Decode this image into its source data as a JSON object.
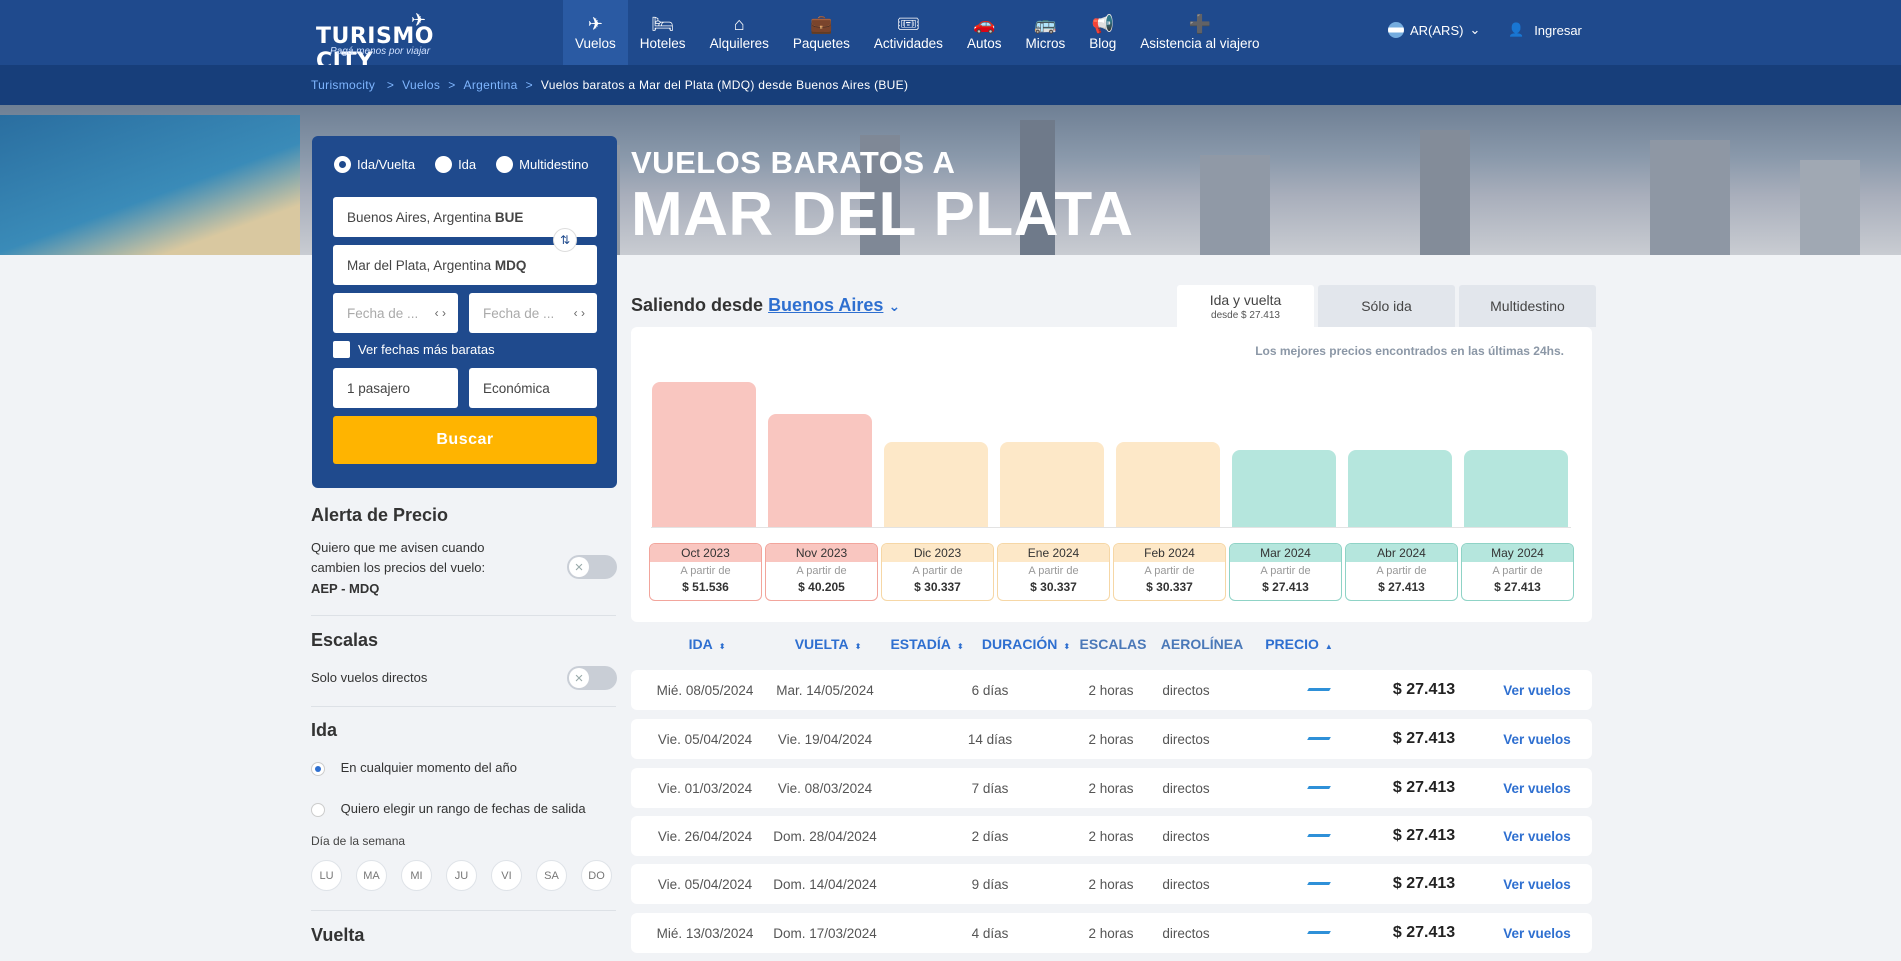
{
  "brand": {
    "name": "TURISMO CITY",
    "slogan": "Pagá menos por viajar"
  },
  "nav": [
    {
      "label": "Vuelos",
      "icon": "plane-icon",
      "glyph": "✈",
      "active": true
    },
    {
      "label": "Hoteles",
      "icon": "bed-icon",
      "glyph": "🛏",
      "active": false
    },
    {
      "label": "Alquileres",
      "icon": "house-icon",
      "glyph": "⌂",
      "active": false
    },
    {
      "label": "Paquetes",
      "icon": "suitcase-icon",
      "glyph": "💼",
      "active": false
    },
    {
      "label": "Actividades",
      "icon": "ticket-icon",
      "glyph": "🎟",
      "active": false
    },
    {
      "label": "Autos",
      "icon": "car-icon",
      "glyph": "🚗",
      "active": false
    },
    {
      "label": "Micros",
      "icon": "bus-icon",
      "glyph": "🚌",
      "active": false
    },
    {
      "label": "Blog",
      "icon": "megaphone-icon",
      "glyph": "📢",
      "active": false
    },
    {
      "label": "Asistencia al viajero",
      "icon": "medkit-icon",
      "glyph": "➕",
      "active": false
    }
  ],
  "currency": "AR(ARS)",
  "login": "Ingresar",
  "breadcrumb": {
    "items": [
      "Turismocity",
      "Vuelos",
      "Argentina"
    ],
    "current": "Vuelos baratos a Mar del Plata (MDQ) desde Buenos Aires (BUE)"
  },
  "hero": {
    "line1": "VUELOS BARATOS A",
    "line2": "MAR DEL PLATA"
  },
  "search": {
    "trip_types": [
      "Ida/Vuelta",
      "Ida",
      "Multidestino"
    ],
    "origin": "Buenos Aires, Argentina",
    "origin_code": "BUE",
    "destination": "Mar del Plata, Argentina",
    "destination_code": "MDQ",
    "date_out_placeholder": "Fecha de ...",
    "date_back_placeholder": "Fecha de ...",
    "cheapest_dates": "Ver fechas más baratas",
    "passengers": "1 pasajero",
    "cabin": "Económica",
    "button": "Buscar"
  },
  "filters": {
    "alert_title": "Alerta de Precio",
    "alert_text": "Quiero que me avisen cuando cambien los precios del vuelo:",
    "alert_route": "AEP - MDQ",
    "stops_title": "Escalas",
    "stops_text": "Solo vuelos directos",
    "ida_title": "Ida",
    "ida_opt1": "En cualquier momento del año",
    "ida_opt2": "Quiero elegir un rango de fechas de salida",
    "weekday_label": "Día de la semana",
    "weekdays": [
      "LU",
      "MA",
      "MI",
      "JU",
      "VI",
      "SA",
      "DO"
    ],
    "vuelta_title": "Vuelta"
  },
  "leaving": {
    "prefix": "Saliendo desde",
    "city": "Buenos Aires"
  },
  "trip_tabs": [
    {
      "label": "Ida y vuelta",
      "sub": "desde $ 27.413",
      "active": true
    },
    {
      "label": "Sólo ida",
      "sub": "",
      "active": false
    },
    {
      "label": "Multidestino",
      "sub": "",
      "active": false
    }
  ],
  "best_prices": "Los mejores precios encontrados en las últimas 24hs.",
  "chart_data": {
    "type": "bar",
    "categories": [
      "Oct 2023",
      "Nov 2023",
      "Dic 2023",
      "Ene 2024",
      "Feb 2024",
      "Mar 2024",
      "Abr 2024",
      "May 2024"
    ],
    "values": [
      51536,
      40205,
      30337,
      30337,
      30337,
      27413,
      27413,
      27413
    ],
    "labels": [
      "$ 51.536",
      "$ 40.205",
      "$ 30.337",
      "$ 30.337",
      "$ 30.337",
      "$ 27.413",
      "$ 27.413",
      "$ 27.413"
    ],
    "sub_label": "A partir de",
    "tiers": [
      "high",
      "high",
      "mid",
      "mid",
      "mid",
      "low",
      "low",
      "low"
    ],
    "colors": {
      "high": "#f9c6c0",
      "mid": "#fde8c8",
      "low": "#b5e6dd"
    },
    "border_colors": {
      "high": "#f2a59c",
      "mid": "#f6d7a6",
      "low": "#8fd3c6"
    }
  },
  "table": {
    "columns": [
      "IDA",
      "VUELTA",
      "ESTADÍA",
      "DURACIÓN",
      "ESCALAS",
      "AEROLÍNEA",
      "PRECIO"
    ],
    "action": "Ver vuelos",
    "rows": [
      {
        "ida": "Mié. 08/05/2024",
        "vuelta": "Mar. 14/05/2024",
        "estadia": "6 días",
        "duracion": "2 horas",
        "escalas": "directos",
        "precio": "$ 27.413"
      },
      {
        "ida": "Vie. 05/04/2024",
        "vuelta": "Vie. 19/04/2024",
        "estadia": "14 días",
        "duracion": "2 horas",
        "escalas": "directos",
        "precio": "$ 27.413"
      },
      {
        "ida": "Vie. 01/03/2024",
        "vuelta": "Vie. 08/03/2024",
        "estadia": "7 días",
        "duracion": "2 horas",
        "escalas": "directos",
        "precio": "$ 27.413"
      },
      {
        "ida": "Vie. 26/04/2024",
        "vuelta": "Dom. 28/04/2024",
        "estadia": "2 días",
        "duracion": "2 horas",
        "escalas": "directos",
        "precio": "$ 27.413"
      },
      {
        "ida": "Vie. 05/04/2024",
        "vuelta": "Dom. 14/04/2024",
        "estadia": "9 días",
        "duracion": "2 horas",
        "escalas": "directos",
        "precio": "$ 27.413"
      },
      {
        "ida": "Mié. 13/03/2024",
        "vuelta": "Dom. 17/03/2024",
        "estadia": "4 días",
        "duracion": "2 horas",
        "escalas": "directos",
        "precio": "$ 27.413"
      }
    ]
  }
}
